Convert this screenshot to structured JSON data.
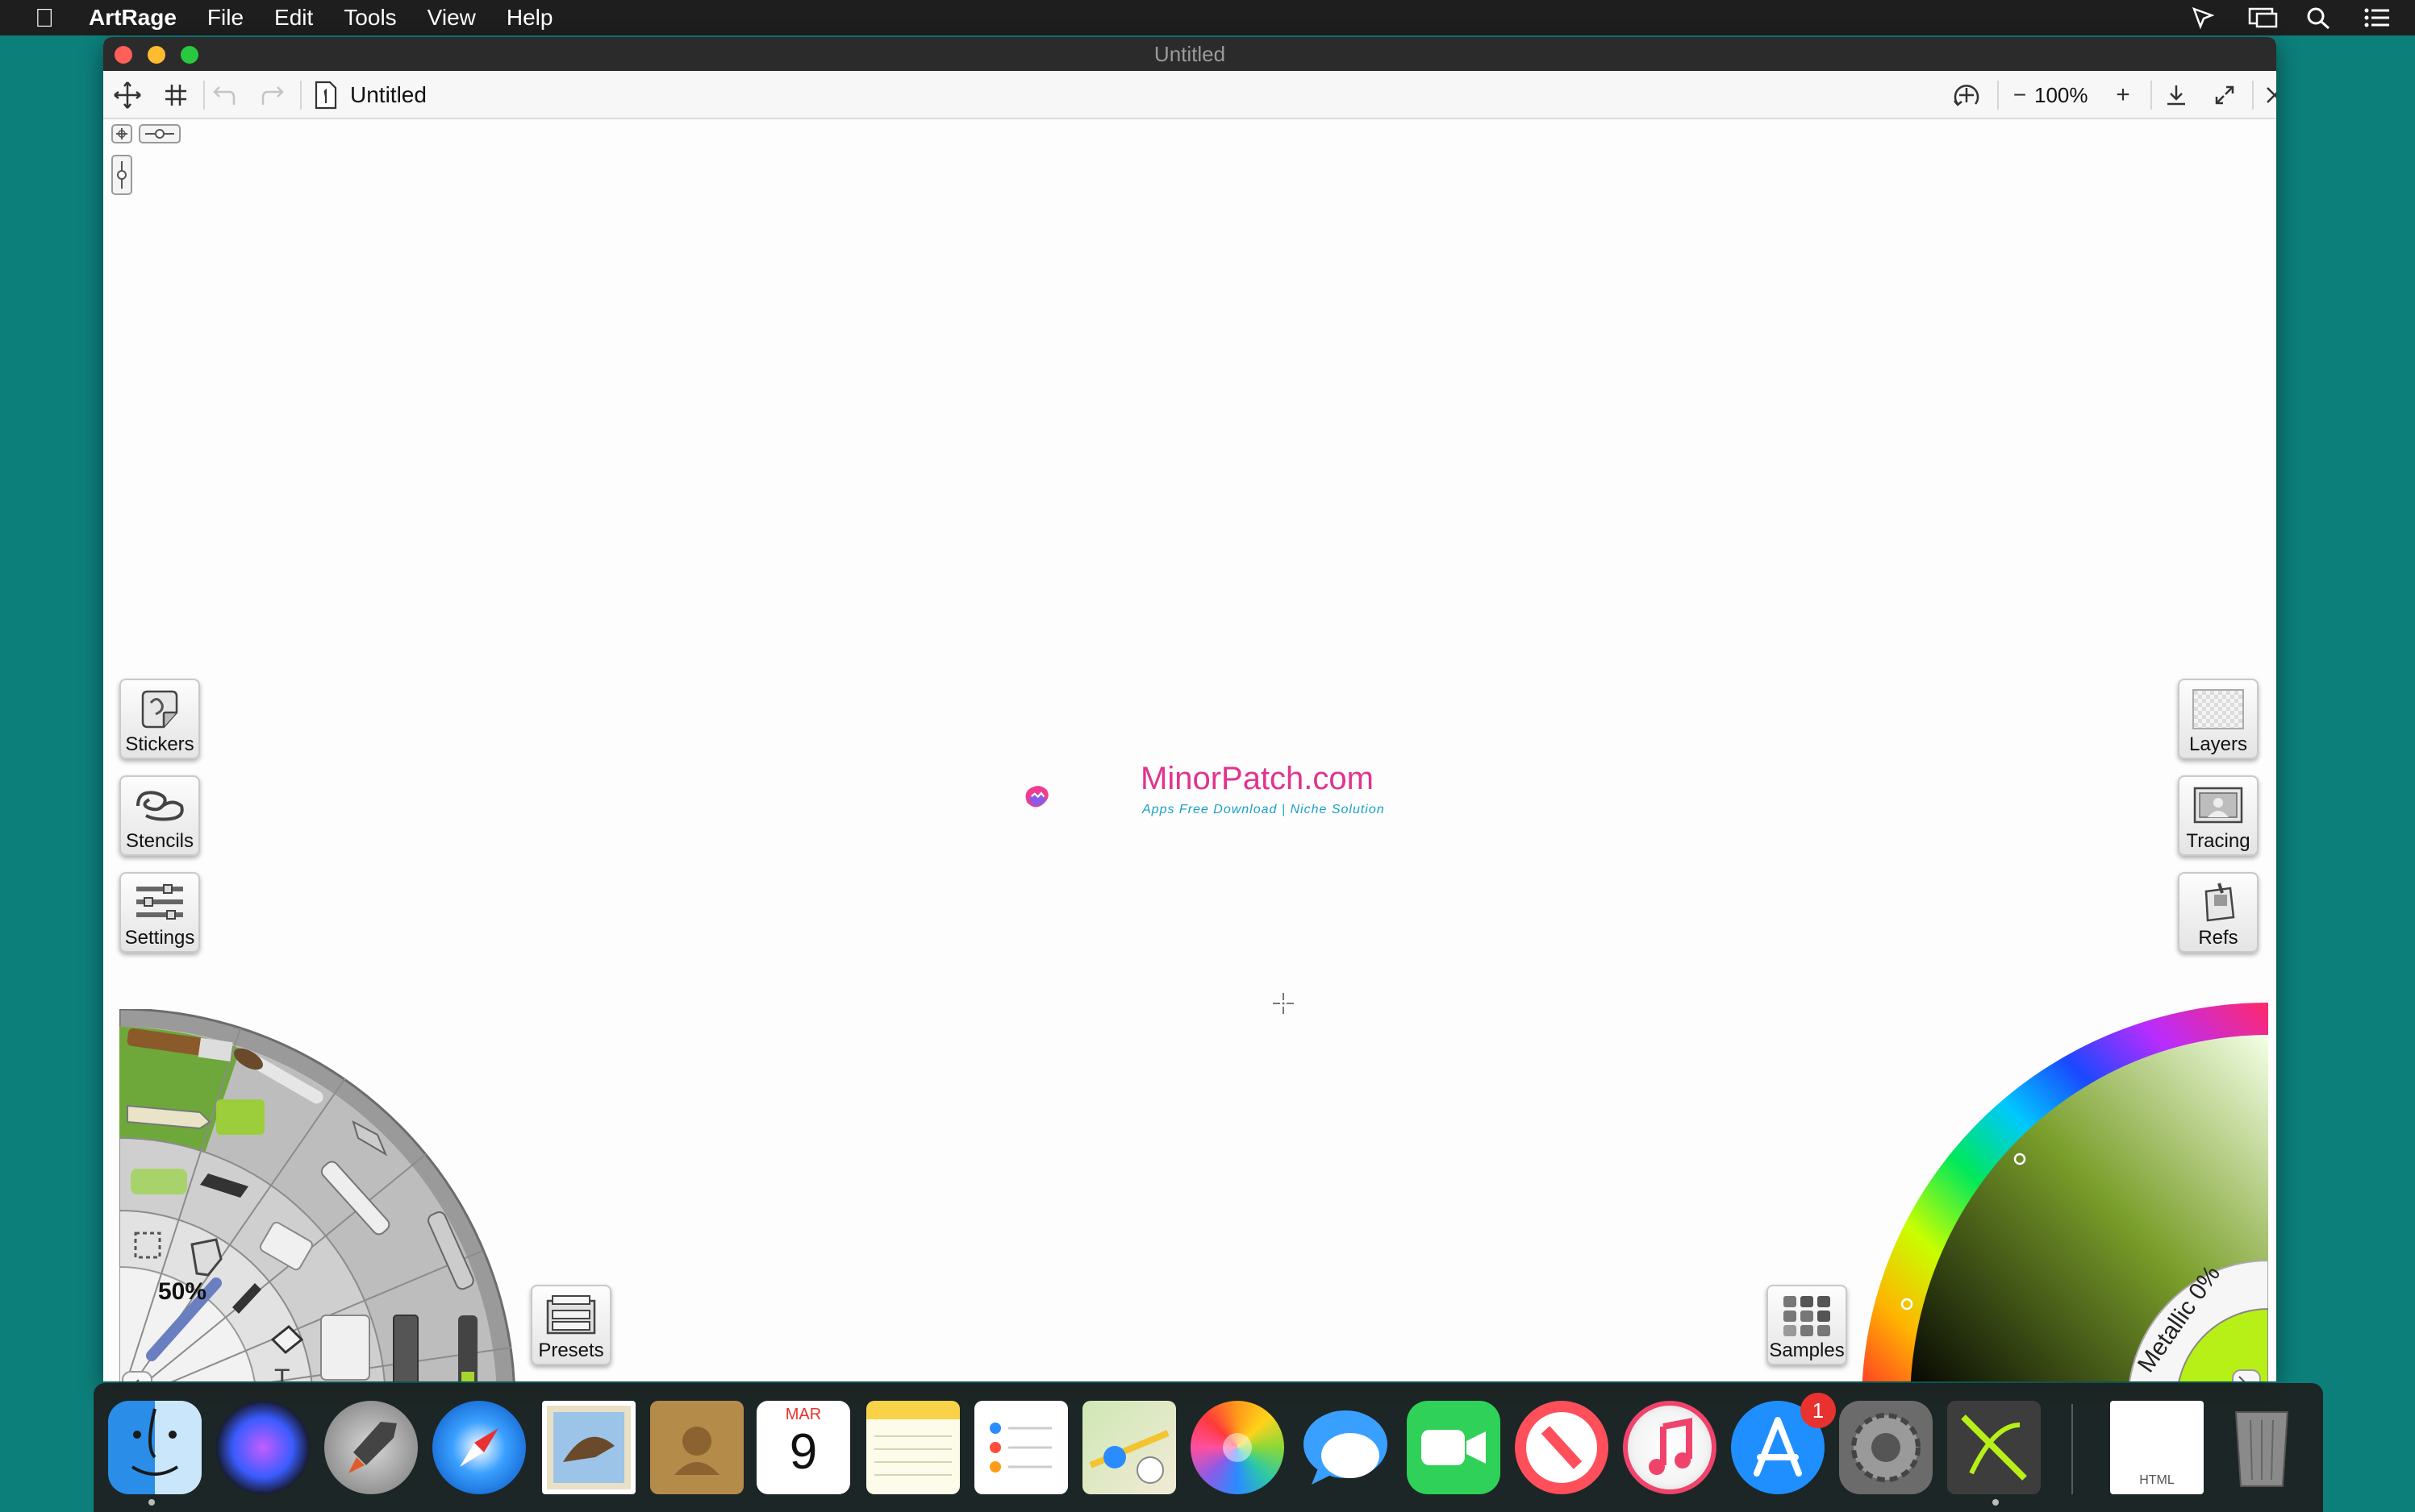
{
  "menubar": {
    "app_name": "ArtRage",
    "items": [
      "File",
      "Edit",
      "Tools",
      "View",
      "Help"
    ]
  },
  "window": {
    "title": "Untitled"
  },
  "toolbar": {
    "document_title": "Untitled",
    "zoom": "100%",
    "zoom_out": "−",
    "zoom_in": "+"
  },
  "left_panel": {
    "stickers": "Stickers",
    "stencils": "Stencils",
    "settings": "Settings",
    "presets": "Presets"
  },
  "right_panel": {
    "layers": "Layers",
    "tracing": "Tracing",
    "refs": "Refs",
    "samples": "Samples"
  },
  "tool_wheel": {
    "size": "50%",
    "text_tool": "T"
  },
  "color_picker": {
    "metallic": "Metallic 0%",
    "current_color": "#b7f016"
  },
  "watermark": {
    "title": "MinorPatch.com",
    "subtitle": "Apps Free Download | Niche Solution"
  },
  "dock": {
    "calendar_month": "MAR",
    "calendar_day": "9",
    "badge_count": "1",
    "file_label": "HTML"
  }
}
